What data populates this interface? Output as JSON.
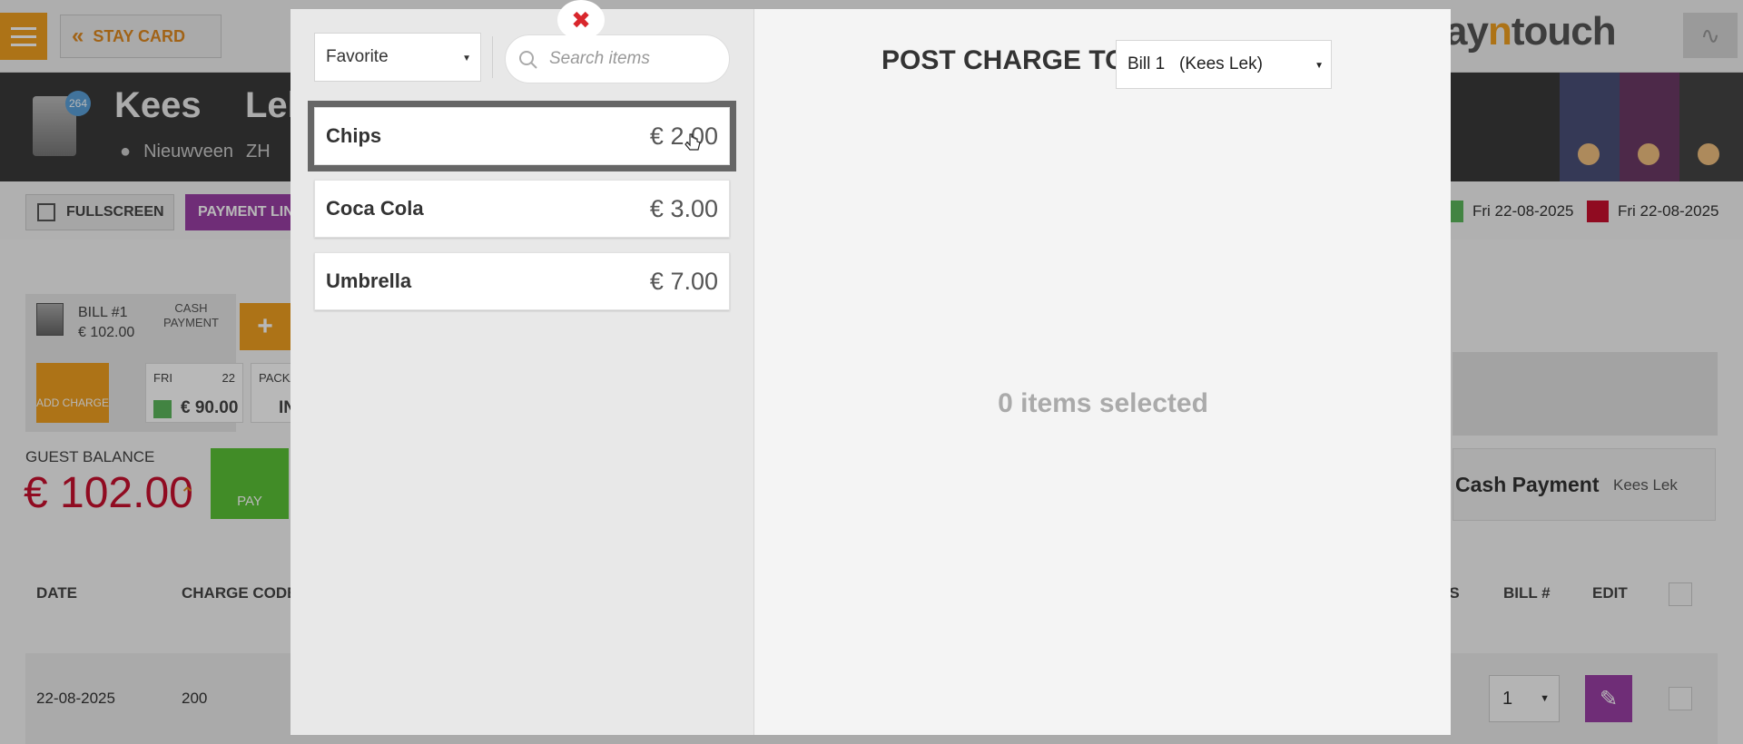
{
  "app": {
    "stay_card_label": "STAY CARD",
    "brand_prefix": "ay",
    "brand_accent": "n",
    "brand_suffix": "touch",
    "guest_first_name": "Kees",
    "guest_last_name_partial": "Lek",
    "guest_city": "Nieuwveen",
    "guest_region": "ZH",
    "avatar_badge": "264",
    "fullscreen_label": "FULLSCREEN",
    "payment_link_label": "PAYMENT LIN",
    "arrival_date": "Fri 22-08-2025",
    "departure_date": "Fri 22-08-2025",
    "bill_card": {
      "title": "BILL #1",
      "amount": "€ 102.00",
      "cash_line1": "CASH",
      "cash_line2": "PAYMENT"
    },
    "add_charge_label": "ADD CHARGE",
    "day_cell": {
      "day": "FRI",
      "date": "22",
      "amount": "€ 90.00"
    },
    "package_cell": {
      "label": "PACKA",
      "value": "IN"
    },
    "guest_balance_label": "GUEST BALANCE",
    "guest_balance_value": "€ 102.00",
    "pay_label": "PAY",
    "cash_payment": {
      "title": "Cash Payment",
      "who": "Kees Lek"
    },
    "table_headers": {
      "date": "DATE",
      "charge_code": "CHARGE CODE",
      "ts": "TS",
      "bill_no": "BILL #",
      "edit": "EDIT"
    },
    "table_row": {
      "date": "22-08-2025",
      "code": "200",
      "bill": "1"
    }
  },
  "modal": {
    "category": "Favorite",
    "search_placeholder": "Search items",
    "items": [
      {
        "name": "Chips",
        "price": "€ 2.00",
        "selected": true
      },
      {
        "name": "Coca Cola",
        "price": "€ 3.00",
        "selected": false
      },
      {
        "name": "Umbrella",
        "price": "€ 7.00",
        "selected": false
      }
    ],
    "post_charge_label": "POST CHARGE TO",
    "post_charge_bill": "Bill 1   (Kees Lek)",
    "empty_message": "0 items selected"
  },
  "colors": {
    "accent_orange": "#f0a020",
    "purple": "#9a3fa6",
    "balance_red": "#c8102e",
    "pay_green": "#5bc236",
    "close_red": "#d9262c"
  },
  "icons": [
    "hamburger-icon",
    "chevron-left-icon",
    "search-icon",
    "close-icon",
    "pointer-cursor-icon",
    "caret-down-icon",
    "pencil-icon",
    "location-pin-icon"
  ]
}
